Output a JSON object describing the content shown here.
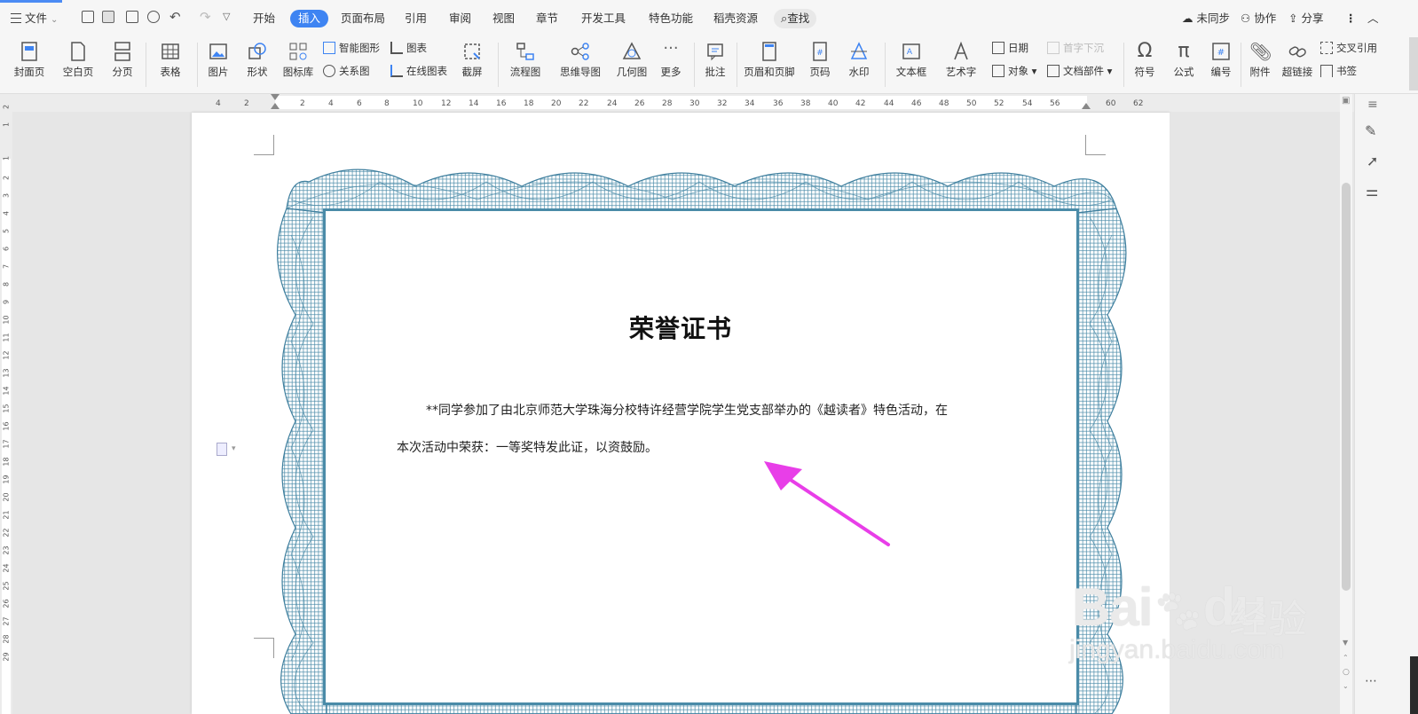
{
  "menubar": {
    "file_label": "文件",
    "tabs": [
      "开始",
      "插入",
      "页面布局",
      "引用",
      "审阅",
      "视图",
      "章节",
      "开发工具",
      "特色功能",
      "稻壳资源"
    ],
    "active_tab": "插入",
    "search_label": "查找",
    "sync_label": "未同步",
    "collab_label": "协作",
    "share_label": "分享"
  },
  "ribbon": {
    "cover": "封面页",
    "blank": "空白页",
    "pagebreak": "分页",
    "table": "表格",
    "picture": "图片",
    "shape": "形状",
    "iconlib": "图标库",
    "smartart": "智能图形",
    "chart": "图表",
    "relation": "关系图",
    "onlinechart": "在线图表",
    "screenshot": "截屏",
    "flowchart": "流程图",
    "mindmap": "思维导图",
    "geometry": "几何图",
    "more": "更多",
    "comment": "批注",
    "headerfooter": "页眉和页脚",
    "pagenum": "页码",
    "watermark": "水印",
    "textbox": "文本框",
    "wordart": "艺术字",
    "date": "日期",
    "object": "对象",
    "dropcap": "首字下沉",
    "docparts": "文档部件",
    "symbol": "符号",
    "formula": "公式",
    "numbering": "编号",
    "attachment": "附件",
    "hyperlink": "超链接",
    "crossref": "交叉引用",
    "bookmark": "书签"
  },
  "ruler": {
    "h_ticks": [
      "4",
      "2",
      "2",
      "4",
      "6",
      "8",
      "10",
      "12",
      "14",
      "16",
      "18",
      "20",
      "22",
      "24",
      "26",
      "28",
      "30",
      "32",
      "34",
      "36",
      "38",
      "40",
      "42",
      "44",
      "46",
      "48",
      "50",
      "52",
      "54",
      "56",
      "60",
      "62"
    ],
    "v_ticks": [
      "2",
      "1",
      "1",
      "2",
      "3",
      "4",
      "5",
      "6",
      "7",
      "8",
      "9",
      "10",
      "11",
      "12",
      "13",
      "14",
      "15",
      "16",
      "17",
      "18",
      "19",
      "20",
      "21",
      "22",
      "23",
      "24",
      "25",
      "26",
      "27",
      "28",
      "29"
    ]
  },
  "document": {
    "title": "荣誉证书",
    "line1": "**同学参加了由北京师范大学珠海分校特许经营学院学生党支部举办的《越读者》特色活动，在",
    "line2": "本次活动中荣获：一等奖特发此证，以资鼓励。"
  },
  "watermark": {
    "logo": "Bai",
    "logo2": "du",
    "cn": "经验",
    "url": "jingyan.baidu.com"
  },
  "colors": {
    "accent": "#3e84f2",
    "border": "#4a8ba8",
    "arrow": "#e83ee8"
  }
}
